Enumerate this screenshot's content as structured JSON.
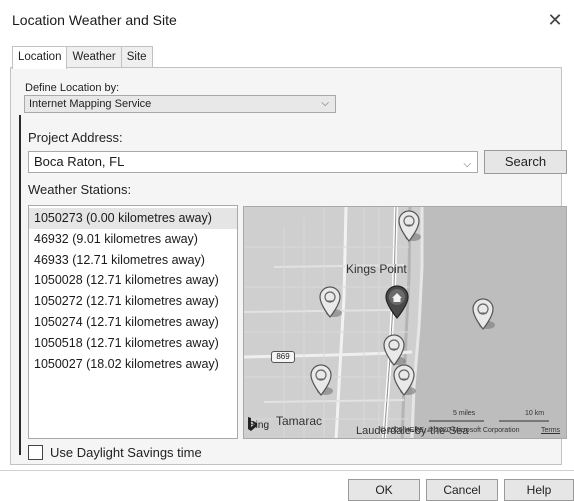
{
  "window": {
    "title": "Location Weather and Site",
    "close_glyph": "✕"
  },
  "tabs": [
    {
      "label": "Location",
      "active": true
    },
    {
      "label": "Weather",
      "active": false
    },
    {
      "label": "Site",
      "active": false
    }
  ],
  "define_location": {
    "label": "Define Location by:",
    "selected": "Internet Mapping Service"
  },
  "project_address": {
    "label": "Project Address:",
    "value": "Boca Raton, FL",
    "search_label": "Search"
  },
  "weather_stations": {
    "label": "Weather Stations:",
    "items": [
      "1050273 (0.00 kilometres away)",
      "46932 (9.01 kilometres away)",
      "46933 (12.71 kilometres away)",
      "1050028 (12.71 kilometres away)",
      "1050272 (12.71 kilometres away)",
      "1050274 (12.71 kilometres away)",
      "1050518 (12.71 kilometres away)",
      "1050027 (18.02 kilometres away)"
    ],
    "selected_index": 0
  },
  "map": {
    "city_label_1": "Kings Point",
    "city_label_2": "Tamarac",
    "city_label_3": "Lauderdale-by-the-Sea",
    "road_shield": "869",
    "provider": "Bing",
    "scale_miles": "5 miles",
    "scale_km": "10 km",
    "copyright": "© 2020 HERE, © 2020 Microsoft Corporation",
    "terms": "Terms",
    "icons": {
      "station": "weather-station-pin-icon",
      "home": "home-pin-icon"
    }
  },
  "daylight_savings": {
    "label": "Use Daylight Savings time",
    "checked": false
  },
  "buttons": {
    "ok": "OK",
    "cancel": "Cancel",
    "help": "Help"
  }
}
